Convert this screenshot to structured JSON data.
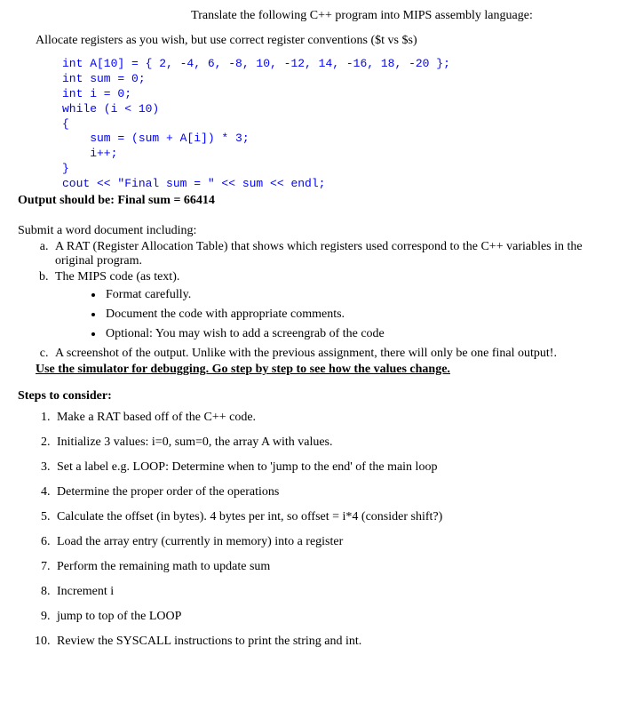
{
  "title": "Translate the following C++ program into MIPS assembly language:",
  "allocate": "Allocate registers as you wish, but use correct register conventions ($t vs $s)",
  "code": {
    "l1": "int A[10] = { 2, -4, 6, -8, 10, -12, 14, -16, 18, -20 };",
    "l2": "int sum = 0;",
    "l3": "int i = 0;",
    "l4": "",
    "l5": "while (i < 10)",
    "l6": "{",
    "l7": "    sum = (sum + A[i]) * 3;",
    "l8": "    i++;",
    "l9": "}",
    "l10": "cout << \"Final sum = \" << sum << endl;"
  },
  "output_label": "Output should be: Final sum = 66414",
  "submit": "Submit a word document including:",
  "letters": {
    "a_text": "A RAT (Register Allocation Table) that shows which registers used correspond to the C++ variables in the original program.",
    "b_text": "The MIPS code (as text).",
    "c_text": "A screenshot of the output. Unlike with the previous assignment, there will only be one final output!."
  },
  "bullets": {
    "b1": "Format carefully.",
    "b2": "Document the code with appropriate comments.",
    "b3": "Optional: You may wish to add a screengrab of the code"
  },
  "use_sim": "Use the simulator for debugging. Go step by step to see how the values change.",
  "steps_header": "Steps to consider:",
  "steps": {
    "s1": "Make a RAT based off of the C++ code.",
    "s2": "Initialize 3 values: i=0, sum=0, the array A with values.",
    "s3": "Set a label e.g. LOOP: Determine when to 'jump to the end' of the main loop",
    "s4": "Determine the proper order of the operations",
    "s5": "Calculate the offset (in bytes). 4 bytes per int, so offset = i*4 (consider shift?)",
    "s6": "Load the array entry (currently in memory) into a register",
    "s7": "Perform the remaining math to update sum",
    "s8": "Increment i",
    "s9": "jump to top of the LOOP",
    "s10": "Review the SYSCALL instructions to print the string and int."
  }
}
